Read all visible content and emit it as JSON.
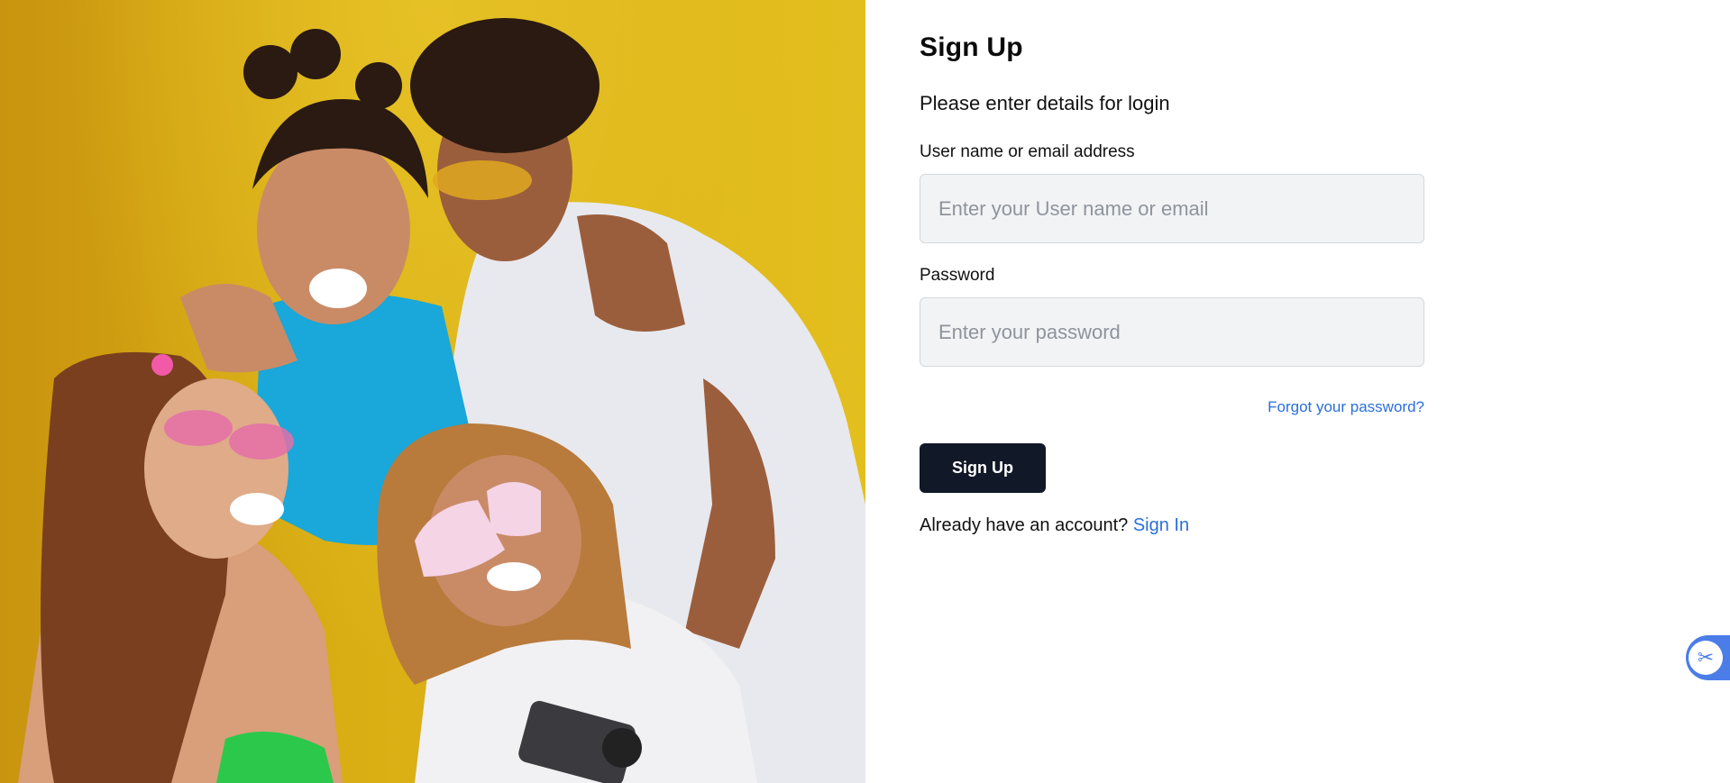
{
  "hero": {
    "description_icon": "photo-of-four-friends",
    "background_color": "#d9ae14"
  },
  "form": {
    "title": "Sign Up",
    "subtitle": "Please enter details for login",
    "username": {
      "label": "User name or email address",
      "placeholder": "Enter your User name or email",
      "value": ""
    },
    "password": {
      "label": "Password",
      "placeholder": "Enter your password",
      "value": ""
    },
    "forgot_link": "Forgot your password?",
    "submit_label": "Sign Up",
    "already_text": "Already have an account?",
    "signin_link": "Sign In"
  },
  "widget": {
    "icon": "scissors-icon",
    "glyph": "✂"
  },
  "colors": {
    "accent": "#2a6fdb",
    "button": "#111827",
    "input_bg": "#f2f3f5",
    "widget": "#4a7de8"
  }
}
